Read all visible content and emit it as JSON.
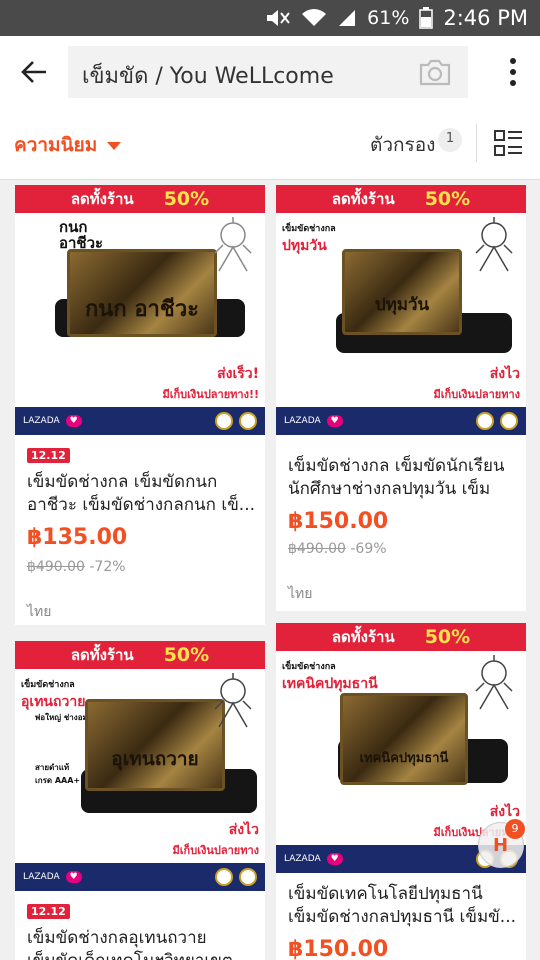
{
  "status_bar": {
    "battery_percent": "61%",
    "time": "2:46 PM",
    "icons": [
      "mute-icon",
      "wifi-icon",
      "signal-icon",
      "battery-icon"
    ]
  },
  "search": {
    "query": "เข็มขัด / You WeLLcome",
    "icons": [
      "back-arrow-icon",
      "camera-icon",
      "more-vert-icon"
    ]
  },
  "filters": {
    "sort_label": "ความนิยม",
    "filter_label": "ตัวกรอง",
    "filter_count": "1",
    "icons": [
      "sort-caret-icon",
      "list-layout-icon"
    ]
  },
  "colors": {
    "accent": "#f25022",
    "banner_red": "#e1223a",
    "banner_yellow": "#ffe14d",
    "strip_navy": "#1b2a6b"
  },
  "products": [
    {
      "banner_left": "ลดทั้งร้าน",
      "banner_right": "50%",
      "img_name": "กนก\nอาชีวะ",
      "buckle_text": "กนก อาชีวะ",
      "ship_line1": "ส่งเร็ว!",
      "ship_line2": "มีเก็บเงินปลายทาง!!",
      "strip_brand": "LAZADA",
      "badge": "12.12",
      "title": "เข็มขัดช่างกล เข็มขัดกนก อาชีวะ เข็มขัดช่างกลกนก เข็...",
      "price": "฿135.00",
      "original_price": "฿490.00",
      "discount": "-72%",
      "location": "ไทย"
    },
    {
      "banner_left": "ลดทั้งร้าน",
      "banner_right": "50%",
      "img_top": "เข็มขัดช่างกล",
      "img_name": "ปทุมวัน",
      "buckle_text": "ปทุมวัน",
      "ship_line1": "ส่งไว",
      "ship_line2": "มีเก็บเงินปลายทาง",
      "strip_brand": "LAZADA",
      "title": "เข็มขัดช่างกล เข็มขัดนักเรียน นักศึกษาช่างกลปทุมวัน เข็มขั...",
      "price": "฿150.00",
      "original_price": "฿490.00",
      "discount": "-69%",
      "location": "ไทย"
    },
    {
      "banner_left": "ลดทั้งร้าน",
      "banner_right": "50%",
      "img_top": "เข็มขัดช่างกล",
      "img_name": "อุเทนถวาย",
      "img_sub": "พ่อใหญ่ ช่างอมตะ",
      "img_note": "สายดำแท้\nเกรด AAA+",
      "buckle_text": "อุเทนถวาย",
      "ship_line1": "ส่งไว",
      "ship_line2": "มีเก็บเงินปลายทาง",
      "strip_brand": "LAZADA",
      "badge": "12.12",
      "title": "เข็มขัดช่างกลอุเทนถวาย เข็มขัดเด็กเทคโนฯวิทยาเขต"
    },
    {
      "banner_left": "ลดทั้งร้าน",
      "banner_right": "50%",
      "img_top": "เข็มขัดช่างกล",
      "img_name": "เทคนิคปทุมธานี",
      "buckle_text": "เทคนิคปทุมธานี",
      "ship_line1": "ส่งไว",
      "ship_line2": "มีเก็บเงินปลายทาง",
      "strip_brand": "LAZADA",
      "title": "เข็มขัดเทคโนโลยีปทุมธานี เข็มขัดช่างกลปทุมธานี เข็มขั...",
      "price": "฿150.00"
    }
  ],
  "float_badge": {
    "letter": "H",
    "count": "9"
  }
}
